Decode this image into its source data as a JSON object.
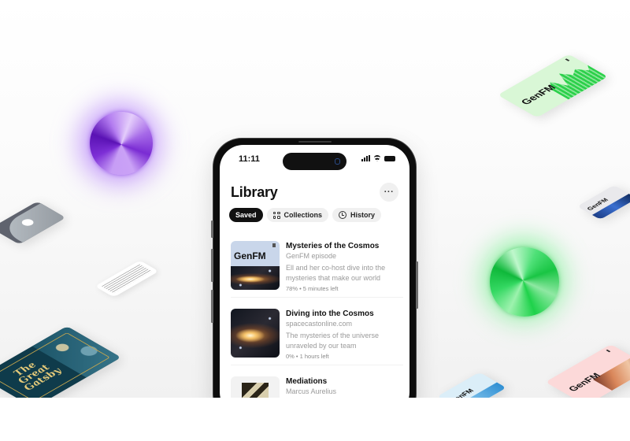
{
  "decor": {
    "cards": [
      {
        "label": "GenFM",
        "pause": "II",
        "color": "#d9f7d6"
      },
      {
        "label": "GenFM",
        "pause": "II",
        "color": "#e9e9ec"
      },
      {
        "label": "GenFM",
        "pause": "II",
        "color": "#dbeef8"
      },
      {
        "label": "GenFM",
        "pause": "II",
        "color": "#fcd9d9"
      },
      {
        "label": "The\nGreat\nGatsby",
        "color": "#0f3b4b"
      }
    ],
    "orbs": [
      {
        "name": "purple-orb",
        "color": "#8a3ee6"
      },
      {
        "name": "green-orb",
        "color": "#1ed24a"
      }
    ]
  },
  "phone": {
    "status_bar": {
      "time": "11:11",
      "icons": [
        "signal-icon",
        "wifi-icon",
        "battery-icon"
      ]
    },
    "header": {
      "title": "Library",
      "more_label": "···"
    },
    "tabs": [
      {
        "label": "Saved",
        "active": true,
        "icon": null
      },
      {
        "label": "Collections",
        "active": false,
        "icon": "grid-icon"
      },
      {
        "label": "History",
        "active": false,
        "icon": "history-icon"
      }
    ],
    "items": [
      {
        "thumb_label": "GenFM",
        "title": "Mysteries of the Cosmos",
        "subtitle": "GenFM episode",
        "description": "Ell and her co-host dive into the mysteries that make our world",
        "meta": "78% • 5 minutes left",
        "progress_percent": 78
      },
      {
        "title": "Diving into the Cosmos",
        "subtitle": "spacecastonline.com",
        "description": "The mysteries of the universe unraveled by our team",
        "meta": "0% • 1 hours left",
        "progress_percent": 0
      },
      {
        "title": "Mediations",
        "subtitle": "Marcus Aurelius"
      }
    ]
  }
}
